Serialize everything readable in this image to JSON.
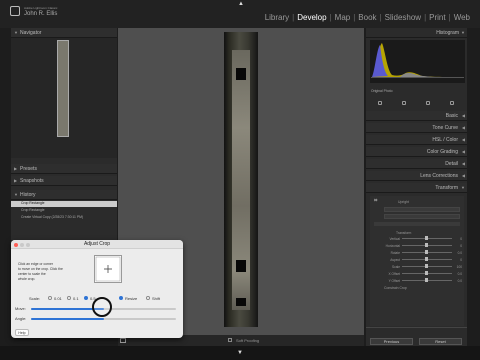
{
  "app": {
    "name": "Adobe Lightroom Classic",
    "user": "John R. Ellis",
    "modules": [
      {
        "label": "Library"
      },
      {
        "label": "Develop"
      },
      {
        "label": "Map"
      },
      {
        "label": "Book"
      },
      {
        "label": "Slideshow"
      },
      {
        "label": "Print"
      },
      {
        "label": "Web"
      }
    ],
    "active_module": "Develop"
  },
  "left_panel": {
    "navigator": {
      "title": "Navigator"
    },
    "presets": {
      "title": "Presets"
    },
    "snapshots": {
      "title": "Snapshots"
    },
    "history": {
      "title": "History",
      "items": [
        {
          "label": "Crop Rectangle"
        },
        {
          "label": "Crop Rectangle"
        },
        {
          "label": "Create Virtual Copy (2/28/23 7:30:11 PM)"
        }
      ]
    }
  },
  "right_panel": {
    "histogram": {
      "title": "Histogram"
    },
    "original_photo_label": "Original Photo",
    "sections": [
      {
        "title": "Basic"
      },
      {
        "title": "Tone Curve"
      },
      {
        "title": "HSL / Color"
      },
      {
        "title": "Color Grading"
      },
      {
        "title": "Detail"
      },
      {
        "title": "Lens Corrections"
      },
      {
        "title": "Transform"
      }
    ],
    "transform": {
      "upright_label": "Upright",
      "transform_label": "Transform",
      "rows": [
        {
          "label": "Vertical",
          "value": "0"
        },
        {
          "label": "Horizontal",
          "value": "0"
        },
        {
          "label": "Rotate",
          "value": "0.0"
        },
        {
          "label": "Aspect",
          "value": "0"
        },
        {
          "label": "Scale",
          "value": "100"
        },
        {
          "label": "X Offset",
          "value": "0.0"
        },
        {
          "label": "Y Offset",
          "value": "0.0"
        }
      ],
      "constrain_label": "Constrain Crop"
    },
    "previous_button": "Previous",
    "reset_button": "Reset"
  },
  "bottom": {
    "soft_proofing": "Soft Proofing"
  },
  "dialog": {
    "title": "Adjust Crop",
    "instructions": [
      "Click an edge or corner",
      "to move on the crop. Click the",
      "center to scale the",
      "whole crop."
    ],
    "scale_label": "Scale:",
    "scale_options": [
      {
        "label": "0.01"
      },
      {
        "label": "0.1"
      },
      {
        "label": "0.5"
      }
    ],
    "resize_label": "Resize",
    "shift_label": "Shift",
    "move_label": "Move:",
    "angle_label": "Angle:",
    "help_button": "Help",
    "move_value": 0.5,
    "angle_value": 0.5
  }
}
